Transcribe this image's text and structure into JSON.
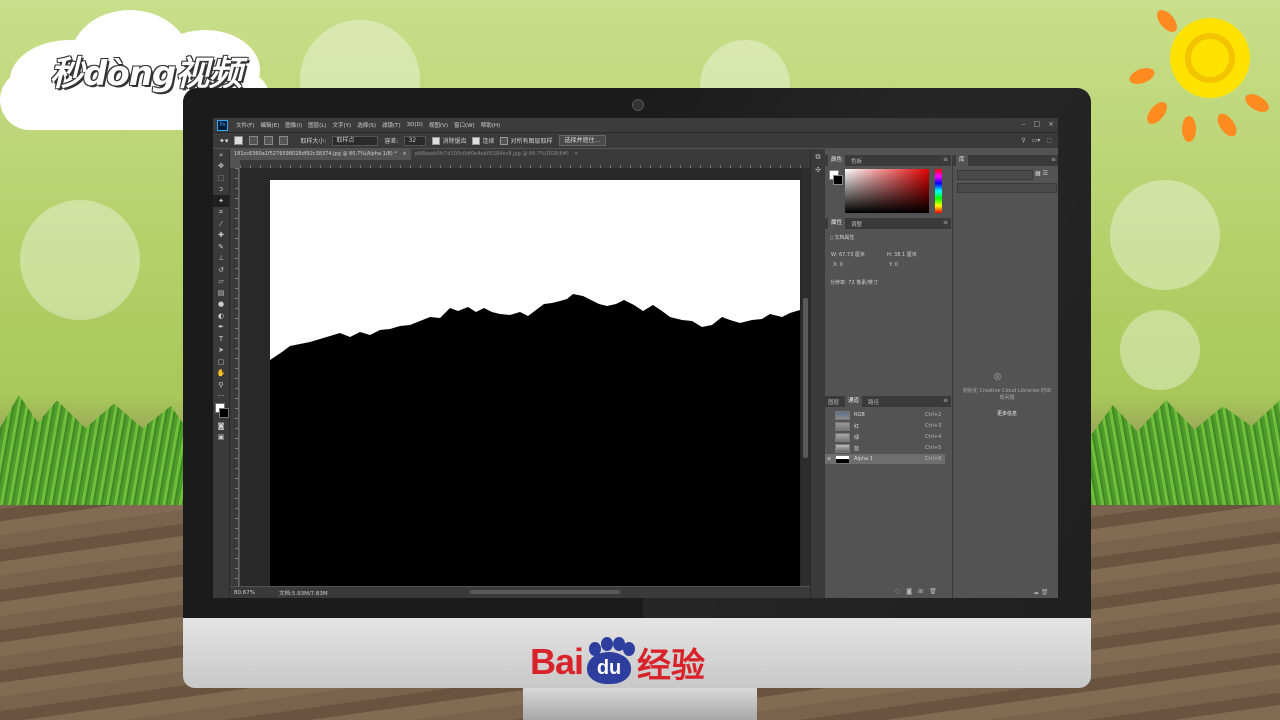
{
  "branding": {
    "corner_logo": "秒dòng视频",
    "baidu_bai": "Bai",
    "baidu_du": "du",
    "baidu_jingyan": "经验"
  },
  "photoshop": {
    "menu": [
      "文件(F)",
      "编辑(E)",
      "图像(I)",
      "图层(L)",
      "文字(Y)",
      "选择(S)",
      "滤镜(T)",
      "3D(D)",
      "视图(V)",
      "窗口(W)",
      "帮助(H)"
    ],
    "options": {
      "sample_size_label": "取样大小:",
      "sample_size_value": "取样点",
      "tolerance_label": "容差:",
      "tolerance_value": "32",
      "antialias_label": "消除锯齿",
      "contiguous_label": "连续",
      "sample_all_label": "对所有图层取样",
      "select_subject_button": "选择并遮住..."
    },
    "tabs": [
      {
        "label": "181cc6360a1f5276598028df92c38374.jpg @ 80.7%(Alpha 1/8) *",
        "active": true
      },
      {
        "label": "a98baeb0fc7d100c0df0e4ab05184ec8.jpg @ 66.7%(RGB/8#)",
        "active": false
      }
    ],
    "status": {
      "zoom": "80.67%",
      "doc_size": "文档:5.93M/7.83M"
    },
    "color_panel": {
      "tabs": [
        "颜色",
        "色板"
      ],
      "fg_color": "#ffffff",
      "bg_color": "#000000",
      "picker_hue": "#e10000"
    },
    "properties_panel": {
      "tabs": [
        "属性",
        "调整"
      ],
      "title": "文档属性",
      "w_label": "W:",
      "w_value": "67.73 厘米",
      "h_label": "H:",
      "h_value": "38.1 厘米",
      "x_label": "X:",
      "x_value": "0",
      "y_label": "Y:",
      "y_value": "0",
      "resolution": "分辨率: 72 像素/英寸"
    },
    "channels_panel": {
      "tabs": [
        "图层",
        "通道",
        "路径"
      ],
      "rows": [
        {
          "name": "RGB",
          "shortcut": "Ctrl+2",
          "visible": false
        },
        {
          "name": "红",
          "shortcut": "Ctrl+3",
          "visible": false
        },
        {
          "name": "绿",
          "shortcut": "Ctrl+4",
          "visible": false
        },
        {
          "name": "蓝",
          "shortcut": "Ctrl+5",
          "visible": false
        },
        {
          "name": "Alpha 1",
          "shortcut": "Ctrl+6",
          "visible": true
        }
      ]
    },
    "libraries_panel": {
      "tab": "库",
      "message": "初始化 Creative Cloud Libraries 时出现问题",
      "link": "更多信息"
    }
  }
}
